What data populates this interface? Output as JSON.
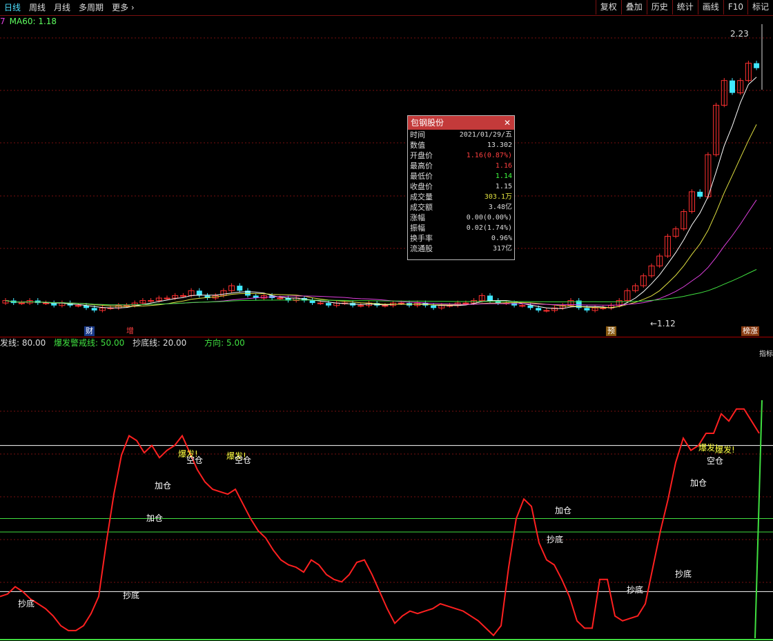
{
  "toolbar": {
    "tabs": [
      "日线",
      "周线",
      "月线",
      "多周期",
      "更多"
    ],
    "more_arrow": "›",
    "right_buttons": [
      "复权",
      "叠加",
      "历史",
      "统计",
      "画线",
      "F10",
      "标记"
    ]
  },
  "ma_row": {
    "prefix": "7",
    "label": "MA60: 1.18"
  },
  "price_chart": {
    "high_label": "2.23",
    "low_label": "←1.12",
    "event_tags": [
      {
        "text": "财",
        "bg": "#1a3a8a",
        "fg": "#ffffff"
      },
      {
        "text": "增",
        "bg": "#000000",
        "fg": "#ff4040"
      },
      {
        "text": "预",
        "bg": "#8a5a10",
        "fg": "#ffffff"
      },
      {
        "text": "榜涨",
        "bg": "#8a3a10",
        "fg": "#ffffff"
      }
    ]
  },
  "indicator_header": [
    {
      "text": "发线: 80.00",
      "color": "#dddddd"
    },
    {
      "text": "爆发警戒线: 50.00",
      "color": "#40e040"
    },
    {
      "text": "抄底线: 20.00",
      "color": "#dddddd"
    },
    {
      "text": "方向: 5.00",
      "color": "#40e040"
    }
  ],
  "indicator_right_label": "指标",
  "signal_labels": {
    "chaodi": "抄底",
    "jiacang": "加仓",
    "baofa": "爆发!",
    "kongcang": "空仓"
  },
  "popup": {
    "title": "包钢股份",
    "close": "✕",
    "rows": [
      {
        "k": "时间",
        "v": "2021/01/29/五",
        "c": ""
      },
      {
        "k": "数值",
        "v": "13.302",
        "c": ""
      },
      {
        "k": "开盘价",
        "v": "1.16(0.87%)",
        "c": "red"
      },
      {
        "k": "最高价",
        "v": "1.16",
        "c": "red"
      },
      {
        "k": "最低价",
        "v": "1.14",
        "c": "green"
      },
      {
        "k": "收盘价",
        "v": "1.15",
        "c": ""
      },
      {
        "k": "成交量",
        "v": "303.1万",
        "c": "yellow"
      },
      {
        "k": "成交额",
        "v": "3.48亿",
        "c": ""
      },
      {
        "k": "涨幅",
        "v": "0.00(0.00%)",
        "c": ""
      },
      {
        "k": "振幅",
        "v": "0.02(1.74%)",
        "c": ""
      },
      {
        "k": "换手率",
        "v": "0.96%",
        "c": ""
      },
      {
        "k": "流通股",
        "v": "317亿",
        "c": ""
      }
    ]
  },
  "colors": {
    "up": "#ff3030",
    "down": "#40e8ff",
    "ma5": "#ffffff",
    "ma10": "#e0e040",
    "ma20": "#e040e0",
    "ma60": "#40e040",
    "indicator": "#ff2020"
  },
  "indicator_levels": [
    80,
    50,
    20
  ],
  "indicator_series": [
    18,
    19,
    22,
    20,
    17,
    15,
    13,
    10,
    6,
    4,
    4,
    6,
    11,
    18,
    40,
    60,
    76,
    84,
    82,
    77,
    80,
    75,
    78,
    80,
    84,
    77,
    70,
    65,
    62,
    61,
    60,
    62,
    56,
    50,
    45,
    42,
    37,
    33,
    31,
    30,
    28,
    33,
    31,
    27,
    25,
    24,
    27,
    32,
    33,
    27,
    20,
    13,
    7,
    10,
    12,
    11,
    12,
    13,
    15,
    14,
    13,
    12,
    10,
    8,
    5,
    2,
    6,
    30,
    50,
    58,
    55,
    40,
    33,
    31,
    25,
    18,
    8,
    5,
    5,
    25,
    25,
    10,
    8,
    9,
    10,
    15,
    30,
    45,
    58,
    73,
    83,
    78,
    80,
    85,
    85,
    93,
    90,
    95,
    95,
    90,
    85
  ],
  "candles": [
    [
      1.15,
      1.16
    ],
    [
      1.16,
      1.15
    ],
    [
      1.15,
      1.15
    ],
    [
      1.15,
      1.16
    ],
    [
      1.16,
      1.15
    ],
    [
      1.15,
      1.15
    ],
    [
      1.15,
      1.14
    ],
    [
      1.14,
      1.15
    ],
    [
      1.15,
      1.14
    ],
    [
      1.14,
      1.14
    ],
    [
      1.14,
      1.13
    ],
    [
      1.13,
      1.12
    ],
    [
      1.12,
      1.13
    ],
    [
      1.13,
      1.13
    ],
    [
      1.13,
      1.14
    ],
    [
      1.14,
      1.14
    ],
    [
      1.14,
      1.15
    ],
    [
      1.15,
      1.16
    ],
    [
      1.16,
      1.16
    ],
    [
      1.16,
      1.17
    ],
    [
      1.17,
      1.17
    ],
    [
      1.17,
      1.18
    ],
    [
      1.18,
      1.18
    ],
    [
      1.18,
      1.2
    ],
    [
      1.2,
      1.18
    ],
    [
      1.18,
      1.17
    ],
    [
      1.17,
      1.18
    ],
    [
      1.18,
      1.2
    ],
    [
      1.2,
      1.22
    ],
    [
      1.22,
      1.2
    ],
    [
      1.2,
      1.18
    ],
    [
      1.18,
      1.17
    ],
    [
      1.17,
      1.18
    ],
    [
      1.18,
      1.17
    ],
    [
      1.17,
      1.17
    ],
    [
      1.17,
      1.16
    ],
    [
      1.16,
      1.17
    ],
    [
      1.17,
      1.16
    ],
    [
      1.16,
      1.15
    ],
    [
      1.15,
      1.15
    ],
    [
      1.15,
      1.14
    ],
    [
      1.14,
      1.15
    ],
    [
      1.15,
      1.15
    ],
    [
      1.15,
      1.14
    ],
    [
      1.14,
      1.14
    ],
    [
      1.14,
      1.15
    ],
    [
      1.15,
      1.14
    ],
    [
      1.14,
      1.14
    ],
    [
      1.14,
      1.15
    ],
    [
      1.15,
      1.15
    ],
    [
      1.15,
      1.14
    ],
    [
      1.14,
      1.15
    ],
    [
      1.15,
      1.14
    ],
    [
      1.14,
      1.13
    ],
    [
      1.13,
      1.14
    ],
    [
      1.14,
      1.14
    ],
    [
      1.14,
      1.15
    ],
    [
      1.15,
      1.15
    ],
    [
      1.15,
      1.16
    ],
    [
      1.16,
      1.18
    ],
    [
      1.18,
      1.16
    ],
    [
      1.16,
      1.15
    ],
    [
      1.15,
      1.15
    ],
    [
      1.15,
      1.14
    ],
    [
      1.14,
      1.14
    ],
    [
      1.14,
      1.13
    ],
    [
      1.13,
      1.12
    ],
    [
      1.12,
      1.12
    ],
    [
      1.12,
      1.13
    ],
    [
      1.13,
      1.14
    ],
    [
      1.14,
      1.16
    ],
    [
      1.16,
      1.13
    ],
    [
      1.13,
      1.12
    ],
    [
      1.12,
      1.13
    ],
    [
      1.13,
      1.13
    ],
    [
      1.13,
      1.14
    ],
    [
      1.14,
      1.16
    ],
    [
      1.16,
      1.2
    ],
    [
      1.2,
      1.22
    ],
    [
      1.22,
      1.26
    ],
    [
      1.26,
      1.3
    ],
    [
      1.3,
      1.34
    ],
    [
      1.34,
      1.42
    ],
    [
      1.42,
      1.45
    ],
    [
      1.45,
      1.52
    ],
    [
      1.52,
      1.6
    ],
    [
      1.6,
      1.58
    ],
    [
      1.58,
      1.75
    ],
    [
      1.75,
      1.95
    ],
    [
      1.95,
      2.05
    ],
    [
      2.05,
      2.0
    ],
    [
      2.0,
      2.05
    ],
    [
      2.05,
      2.12
    ],
    [
      2.12,
      2.1
    ]
  ]
}
